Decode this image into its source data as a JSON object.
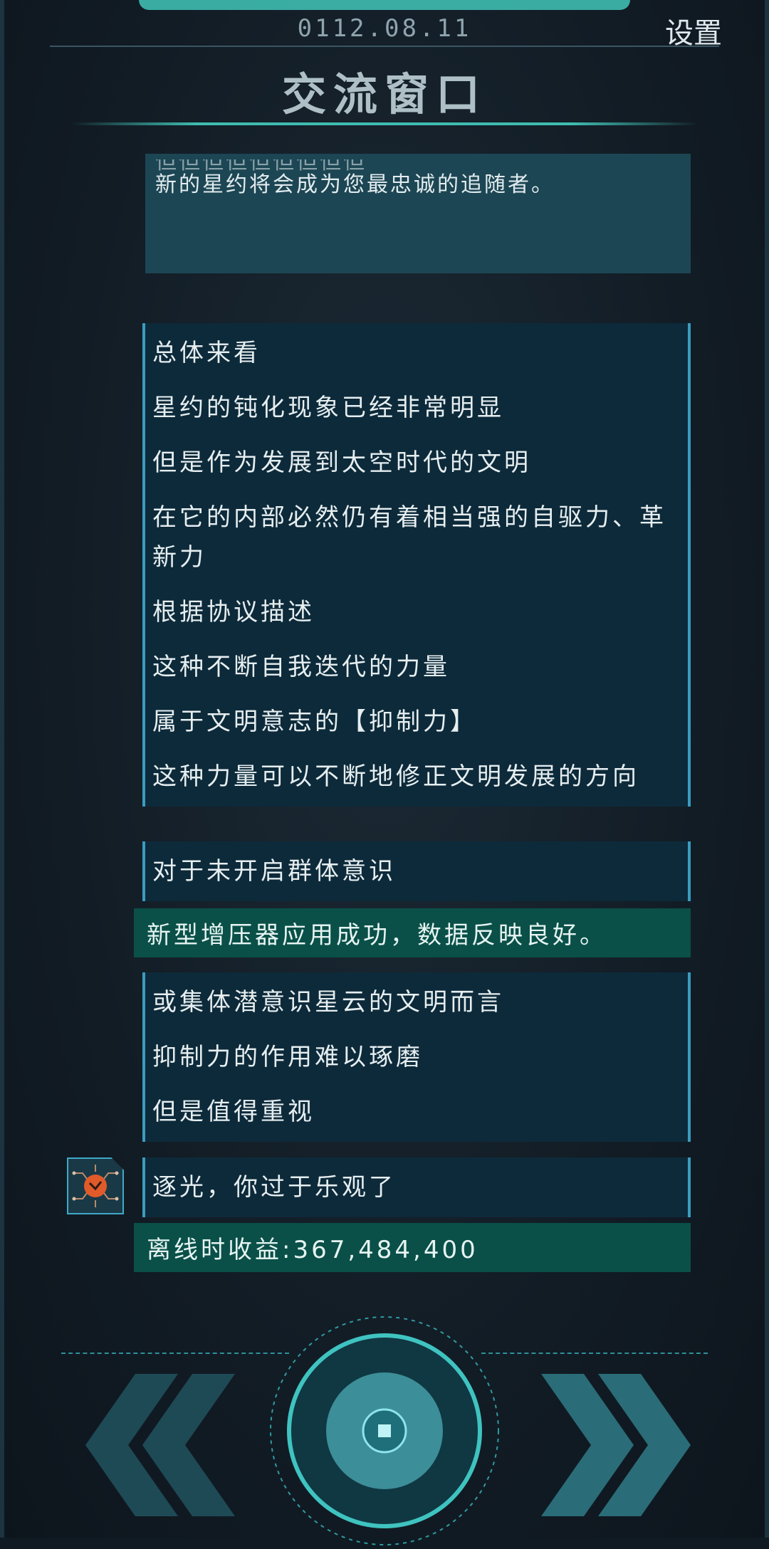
{
  "header": {
    "date": "0112.08.11",
    "settings_label": "设置",
    "title": "交流窗口"
  },
  "intro_card": {
    "cut_line": "但但但但但但但但但",
    "text": "新的星约将会成为您最忠诚的追随者。"
  },
  "messages": [
    {
      "text": "总体来看"
    },
    {
      "text": "星约的钝化现象已经非常明显"
    },
    {
      "text": "但是作为发展到太空时代的文明"
    },
    {
      "text": "在它的内部必然仍有着相当强的自驱力、革新力"
    },
    {
      "text": "根据协议描述"
    },
    {
      "text": "这种不断自我迭代的力量"
    },
    {
      "text": "属于文明意志的【抑制力】"
    },
    {
      "text": "这种力量可以不断地修正文明发展的方向"
    },
    {
      "text": "对于未开启群体意识"
    }
  ],
  "notice_1": "新型增压器应用成功，数据反映良好。",
  "messages_2": [
    {
      "text": "或集体潜意识星云的文明而言"
    },
    {
      "text": "抑制力的作用难以琢磨"
    },
    {
      "text": "但是值得重视"
    }
  ],
  "player_message": "逐光，你过于乐观了",
  "notice_2": "离线时收益:367,484,400",
  "colors": {
    "accent": "#3fbcb0",
    "message_bg": "#0d2a3a",
    "notice_bg": "#0a5048",
    "avatar_core": "#e05a2a"
  },
  "icons": {
    "prev": "double-chevron-left-icon",
    "next": "double-chevron-right-icon",
    "center": "stop-square-icon",
    "avatar": "circuit-orb-icon"
  }
}
